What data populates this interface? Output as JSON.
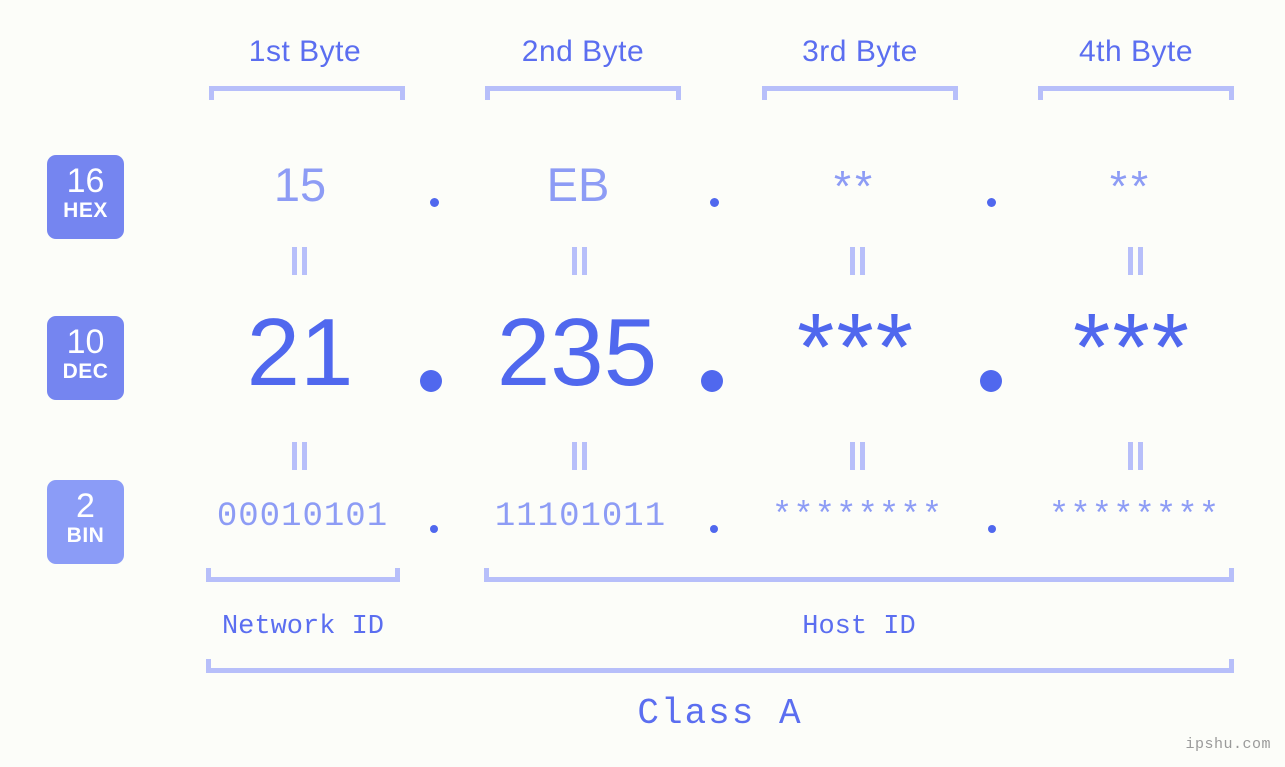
{
  "page": {
    "background_color": "#fcfdf9",
    "accent_color": "#5068ee",
    "accent_light_color": "#8d9cf5",
    "bracket_color": "#b7bffa",
    "header_color": "#5b6ef0"
  },
  "byte_headers": [
    {
      "label": "1st Byte"
    },
    {
      "label": "2nd Byte"
    },
    {
      "label": "3rd Byte"
    },
    {
      "label": "4th Byte"
    }
  ],
  "bases": [
    {
      "number": "16",
      "name": "HEX",
      "badge_color": "#7585f0"
    },
    {
      "number": "10",
      "name": "DEC",
      "badge_color": "#7585f0"
    },
    {
      "number": "2",
      "name": "BIN",
      "badge_color": "#8b9cf7"
    }
  ],
  "rows": {
    "hex": {
      "base_number": "16",
      "base_name": "HEX",
      "values": [
        "15",
        "EB",
        "**",
        "**"
      ],
      "separator": "."
    },
    "dec": {
      "base_number": "10",
      "base_name": "DEC",
      "values": [
        "21",
        "235",
        "***",
        "***"
      ],
      "separator": "."
    },
    "bin": {
      "base_number": "2",
      "base_name": "BIN",
      "values": [
        "00010101",
        "11101011",
        "********",
        "********"
      ],
      "separator": "."
    }
  },
  "equality_symbol": "||",
  "segments": {
    "network_id": "Network ID",
    "host_id": "Host ID"
  },
  "class_label": "Class A",
  "watermark": "ipshu.com"
}
